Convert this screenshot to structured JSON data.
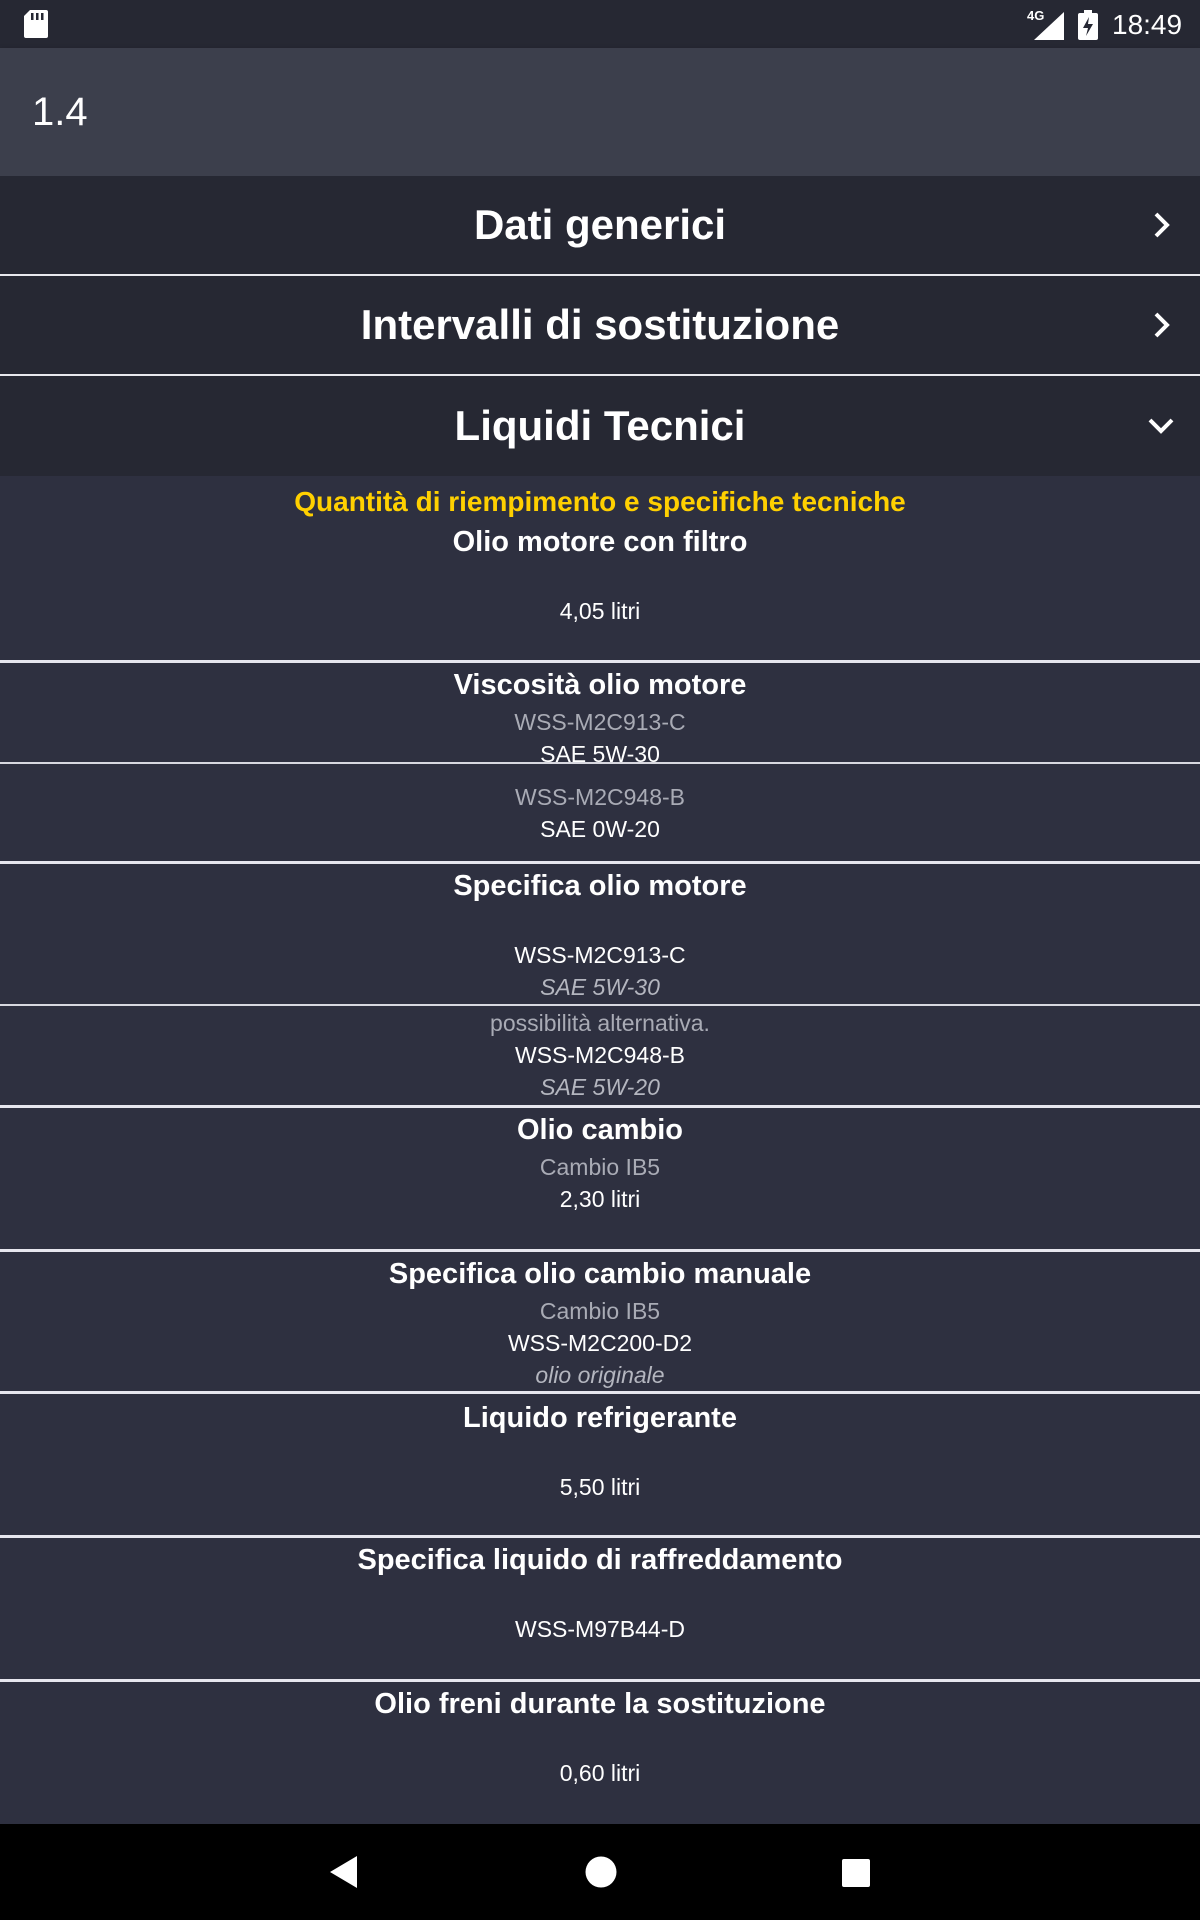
{
  "status_bar": {
    "network": "4G",
    "time": "18:49"
  },
  "app_bar": {
    "title": "1.4"
  },
  "sections": [
    {
      "label": "Dati generici",
      "state": "collapsed"
    },
    {
      "label": "Intervalli di sostituzione",
      "state": "collapsed"
    },
    {
      "label": "Liquidi Tecnici",
      "state": "expanded"
    }
  ],
  "liquids": {
    "subtitle": "Quantità di riempimento e specifiche tecniche",
    "oil_with_filter": {
      "title": "Olio motore con filtro",
      "value": "4,05 litri"
    },
    "oil_viscosity": {
      "title": "Viscosità olio motore",
      "items": [
        {
          "spec": "WSS-M2C913-C",
          "grade": "SAE 5W-30"
        },
        {
          "spec": "WSS-M2C948-B",
          "grade": "SAE 0W-20"
        }
      ]
    },
    "oil_spec": {
      "title": "Specifica olio motore",
      "items": [
        {
          "note": "",
          "spec": "WSS-M2C913-C",
          "grade": "SAE 5W-30"
        },
        {
          "note": "possibilità alternativa.",
          "spec": "WSS-M2C948-B",
          "grade": "SAE 5W-20"
        }
      ]
    },
    "gearbox_oil": {
      "title": "Olio cambio",
      "sub": "Cambio IB5",
      "value": "2,30 litri"
    },
    "manual_gearbox_spec": {
      "title": "Specifica olio cambio manuale",
      "sub": "Cambio IB5",
      "spec": "WSS-M2C200-D2",
      "note": "olio originale"
    },
    "coolant": {
      "title": "Liquido refrigerante",
      "value": "5,50 litri"
    },
    "coolant_spec": {
      "title": "Specifica liquido di raffreddamento",
      "value": "WSS-M97B44-D"
    },
    "brake_fluid": {
      "title": "Olio freni durante la sostituzione",
      "value": "0,60 litri"
    }
  },
  "colors": {
    "background": "#2e3040",
    "header": "#262833",
    "app_bar": "#3c3f4c",
    "accent": "#ffd000"
  },
  "icons": [
    "sd-card-icon",
    "signal-icon",
    "battery-charging-icon",
    "chevron-right-icon",
    "chevron-down-icon",
    "back-icon",
    "home-icon",
    "recents-icon"
  ]
}
